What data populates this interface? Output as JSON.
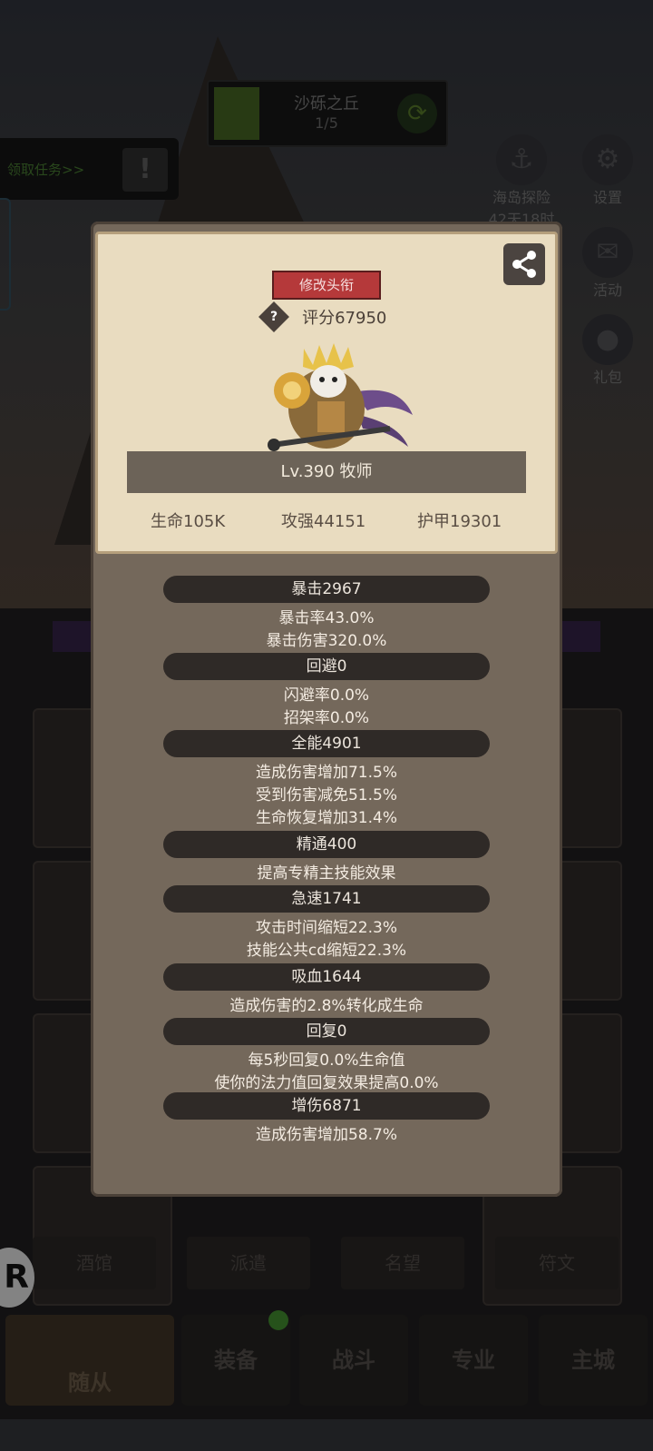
{
  "location": {
    "name": "沙砾之丘",
    "progress": "1/5"
  },
  "quest": {
    "label": "领取任务>>"
  },
  "side_icons": [
    {
      "label": "海岛探险",
      "sub": "42天18时"
    },
    {
      "label": "设置"
    },
    {
      "label": "活动"
    },
    {
      "label": "礼包"
    }
  ],
  "sub_tabs": [
    "酒馆",
    "派遣",
    "名望",
    "符文"
  ],
  "bottom_tabs": [
    "随从",
    "装备",
    "战斗",
    "专业",
    "主城"
  ],
  "hero_panel": {
    "title_button": "修改头衔",
    "score": "评分67950",
    "level": "Lv.390 牧师",
    "hp": "生命105K",
    "attack": "攻强44151",
    "armor": "护甲19301"
  },
  "stats": [
    {
      "header": "暴击2967",
      "lines": [
        "暴击率43.0%",
        "暴击伤害320.0%"
      ]
    },
    {
      "header": "回避0",
      "lines": [
        "闪避率0.0%",
        "招架率0.0%"
      ]
    },
    {
      "header": "全能4901",
      "lines": [
        "造成伤害增加71.5%",
        "受到伤害减免51.5%",
        "生命恢复增加31.4%"
      ]
    },
    {
      "header": "精通400",
      "lines": [
        "提高专精主技能效果"
      ]
    },
    {
      "header": "急速1741",
      "lines": [
        "攻击时间缩短22.3%",
        "技能公共cd缩短22.3%"
      ]
    },
    {
      "header": "吸血1644",
      "lines": [
        "造成伤害的2.8%转化成生命"
      ]
    },
    {
      "header": "回复0",
      "lines": [
        "每5秒回复0.0%生命值",
        "使你的法力值回复效果提高0.0%"
      ]
    },
    {
      "header": "增伤6871",
      "lines": [
        "造成伤害增加58.7%"
      ]
    }
  ]
}
